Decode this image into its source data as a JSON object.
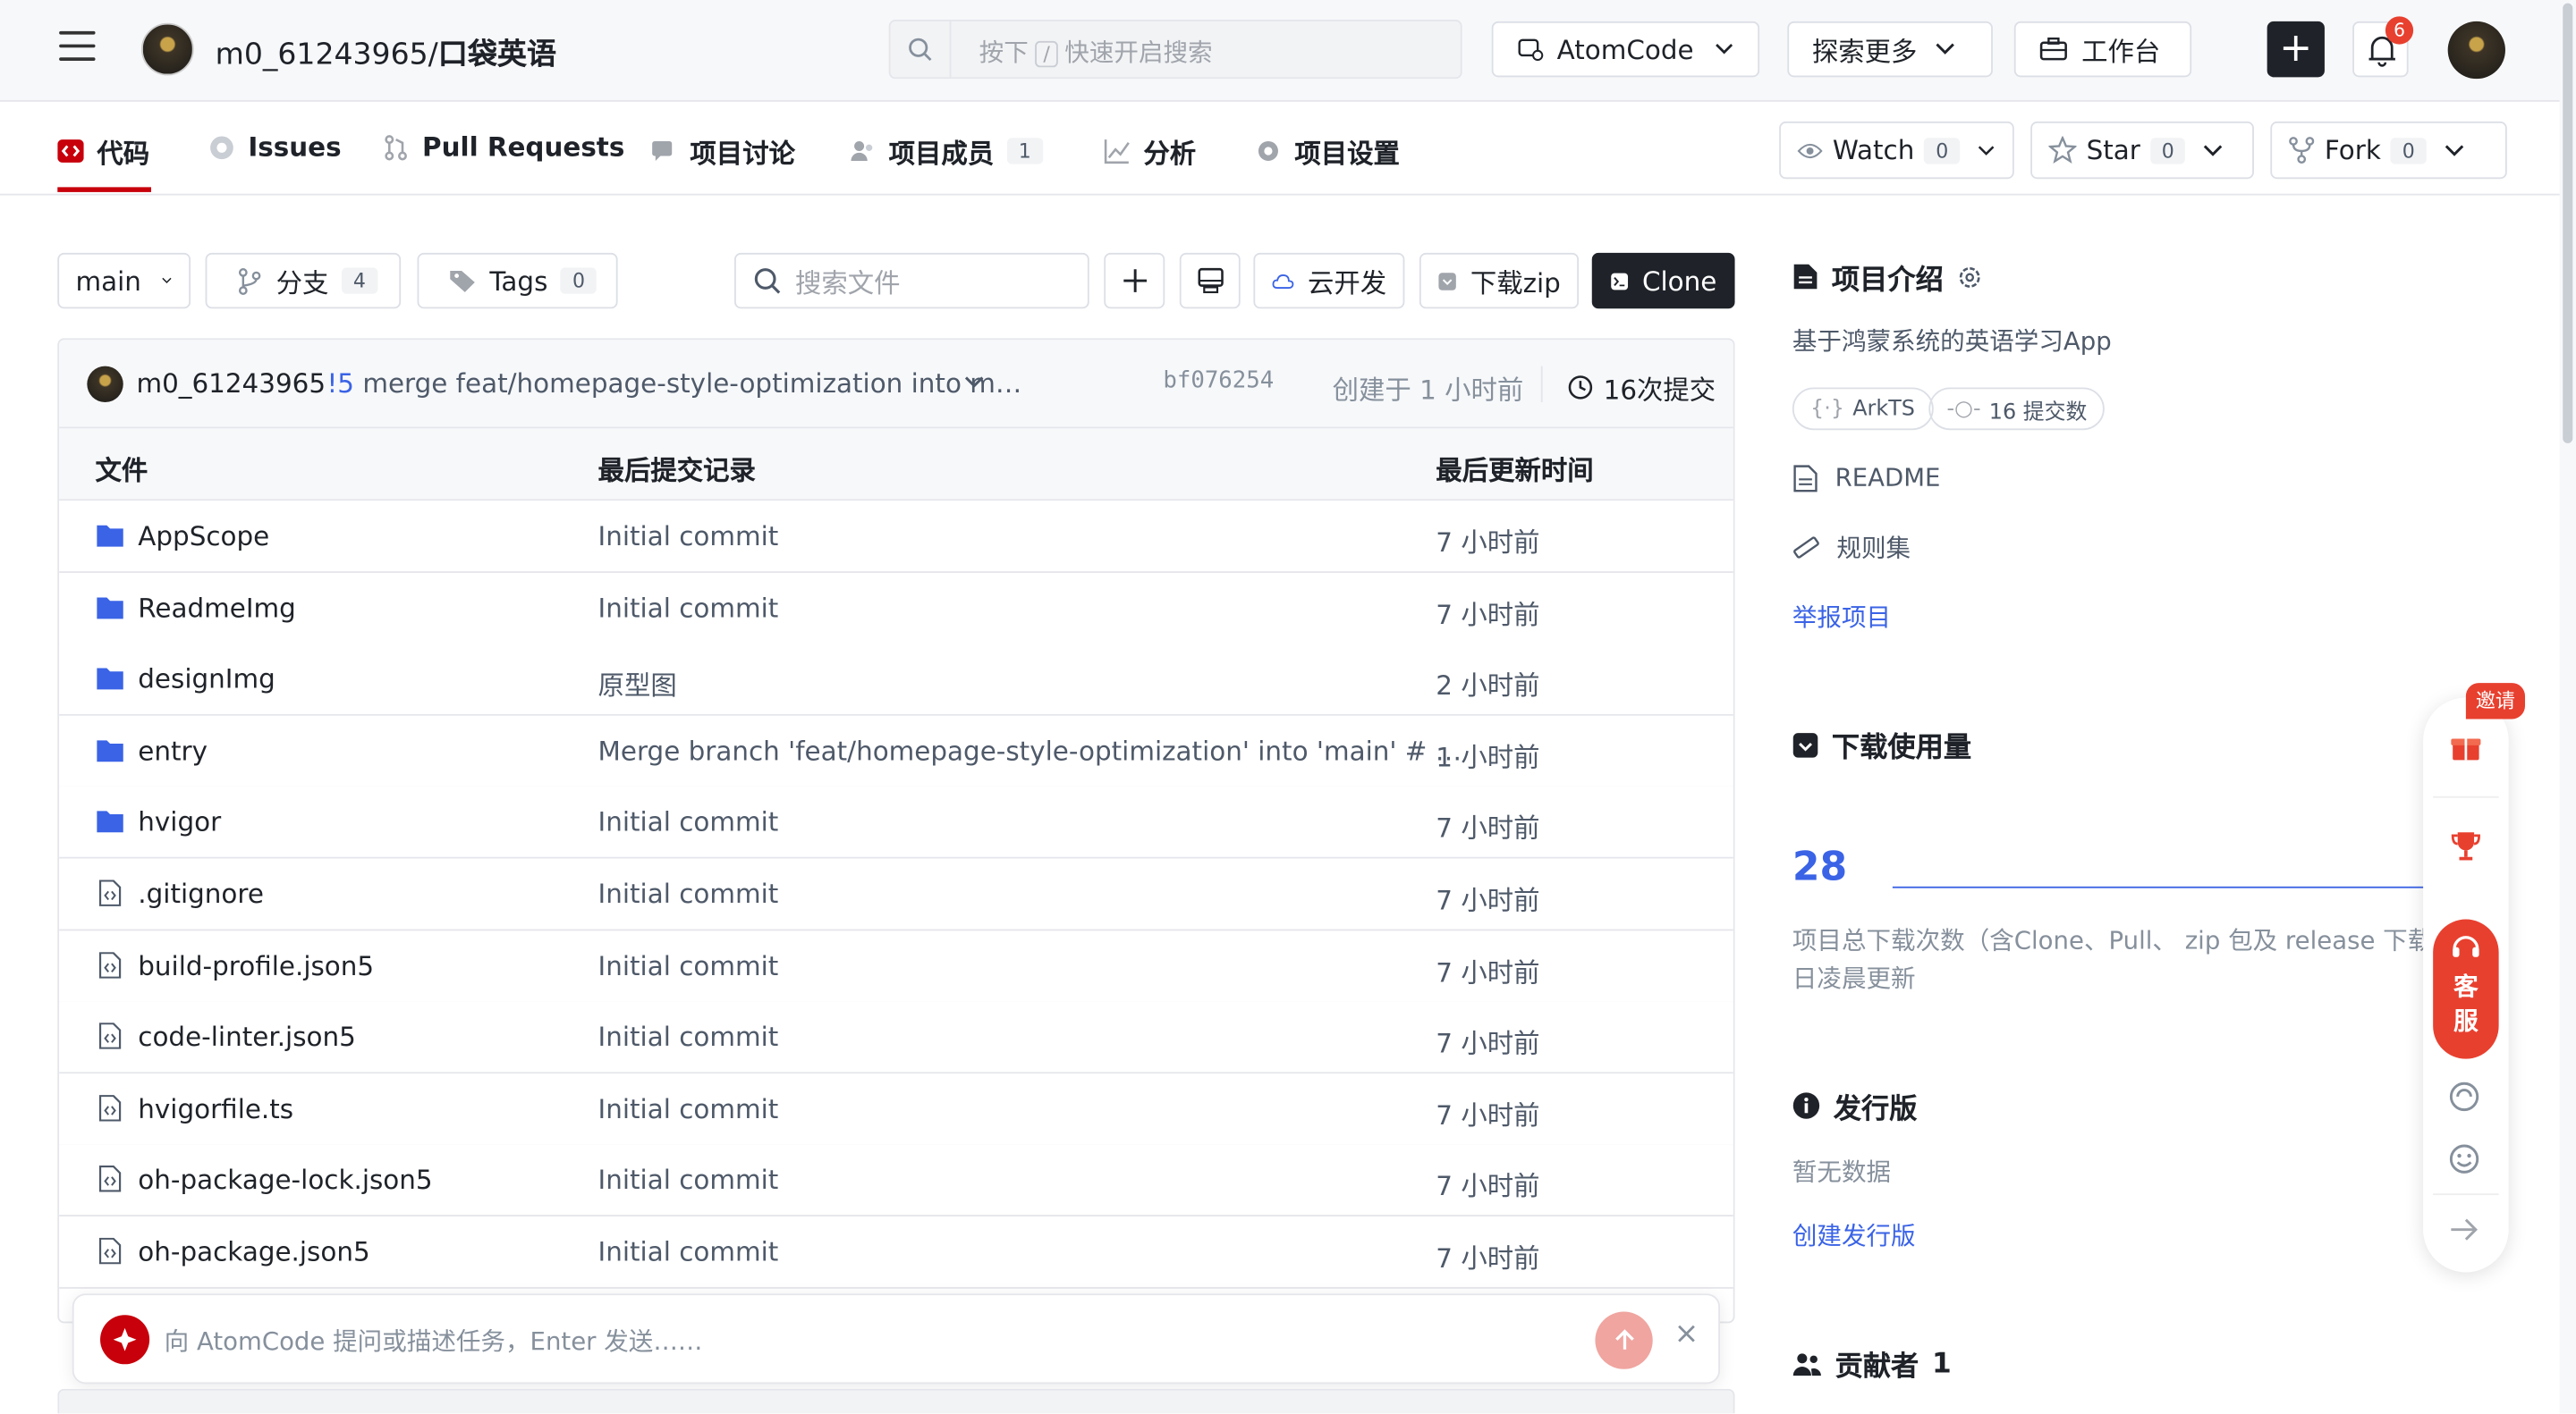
{
  "header": {
    "project_owner": "m0_61243965/",
    "project_name": "口袋英语",
    "search_placeholder_pre": "按下",
    "search_key": "/",
    "search_placeholder_post": "快速开启搜索",
    "atomcode_label": "AtomCode",
    "explore_label": "探索更多",
    "workbench_label": "工作台",
    "plus_label": "+",
    "notification_count": "6"
  },
  "tabs": [
    {
      "label": "代码"
    },
    {
      "label": "Issues"
    },
    {
      "label": "Pull Requests"
    },
    {
      "label": "项目讨论"
    },
    {
      "label": "项目成员",
      "count": "1"
    },
    {
      "label": "分析"
    },
    {
      "label": "项目设置"
    }
  ],
  "social": {
    "watch_label": "Watch",
    "watch_count": "0",
    "star_label": "Star",
    "star_count": "0",
    "fork_label": "Fork",
    "fork_count": "0"
  },
  "toolbar": {
    "branch": "main",
    "branches_label": "分支",
    "branches_count": "4",
    "tags_label": "Tags",
    "tags_count": "0",
    "file_search_placeholder": "搜索文件",
    "cloud_dev_label": "云开发",
    "download_zip_label": "下载zip",
    "clone_label": "Clone"
  },
  "commit": {
    "author": "m0_61243965",
    "pr_ref": "!5",
    "message": " merge feat/homepage-style-optimization into m…",
    "hash": "bf076254",
    "created": "创建于 1 小时前",
    "commit_count": "16次提交"
  },
  "table": {
    "headers": [
      "文件",
      "最后提交记录",
      "最后更新时间"
    ],
    "rows": [
      {
        "type": "folder",
        "name": "AppScope",
        "message": "Initial commit",
        "time": "7 小时前"
      },
      {
        "type": "folder",
        "name": "ReadmeImg",
        "message": "Initial commit",
        "time": "7 小时前"
      },
      {
        "type": "folder",
        "name": "designImg",
        "message": "原型图",
        "time": "2 小时前"
      },
      {
        "type": "folder",
        "name": "entry",
        "message": "Merge branch 'feat/homepage-style-optimization' into 'main' # …",
        "time": "1 小时前"
      },
      {
        "type": "folder",
        "name": "hvigor",
        "message": "Initial commit",
        "time": "7 小时前"
      },
      {
        "type": "file",
        "name": ".gitignore",
        "message": "Initial commit",
        "time": "7 小时前"
      },
      {
        "type": "file",
        "name": "build-profile.json5",
        "message": "Initial commit",
        "time": "7 小时前"
      },
      {
        "type": "file",
        "name": "code-linter.json5",
        "message": "Initial commit",
        "time": "7 小时前"
      },
      {
        "type": "file",
        "name": "hvigorfile.ts",
        "message": "Initial commit",
        "time": "7 小时前"
      },
      {
        "type": "file",
        "name": "oh-package-lock.json5",
        "message": "Initial commit",
        "time": "7 小时前"
      },
      {
        "type": "file",
        "name": "oh-package.json5",
        "message": "Initial commit",
        "time": "7 小时前"
      }
    ]
  },
  "ai_bar": {
    "placeholder": "向 AtomCode 提问或描述任务，Enter 发送……",
    "close": "×"
  },
  "sidebar": {
    "intro_title": "项目介绍",
    "intro_text": "基于鸿蒙系统的英语学习App",
    "lang_pill": "ArkTS",
    "commits_pill": "16 提交数",
    "readme": "README",
    "rules": "规则集",
    "report": "举报项目",
    "downloads_title": "下载使用量",
    "downloads_count": "28",
    "downloads_note_1": "项目总下载次数（含Clone、Pull、 zip 包及 release 下载）",
    "downloads_note_2": "日凌晨更新",
    "releases_title": "发行版",
    "releases_empty": "暂无数据",
    "create_release": "创建发行版",
    "contributors_title": "贡献者",
    "contributors_count": "1"
  },
  "float": {
    "invite": "邀请",
    "support_1": "客",
    "support_2": "服"
  },
  "colors": {
    "accent": "#c7000b",
    "link": "#3a63e6",
    "folder": "#3a63e6",
    "badge": "#e8402f"
  }
}
